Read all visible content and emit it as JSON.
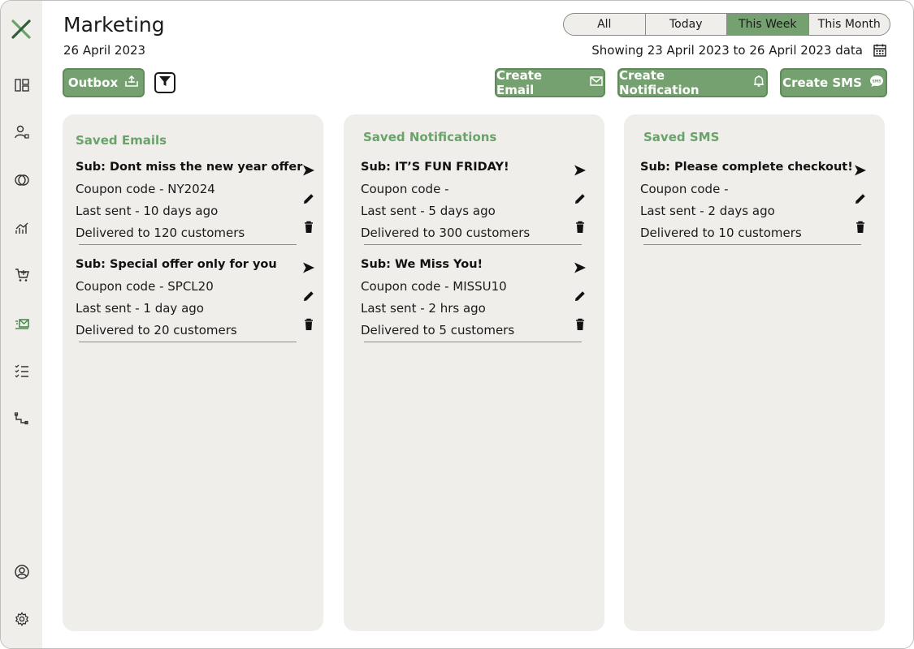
{
  "header": {
    "title": "Marketing",
    "date": "26 April 2023",
    "showing": "Showing 23 April 2023 to 26 April 2023 data"
  },
  "range_tabs": [
    {
      "label": "All",
      "active": false
    },
    {
      "label": "Today",
      "active": false
    },
    {
      "label": "This Week",
      "active": true
    },
    {
      "label": "This Month",
      "active": false
    }
  ],
  "toolbar": {
    "outbox_label": "Outbox",
    "create_email_label": "Create Email",
    "create_notification_label": "Create Notification",
    "create_sms_label": "Create SMS"
  },
  "panels": {
    "emails": {
      "title": "Saved Emails",
      "items": [
        {
          "subject": "Sub: Dont miss the new year offer",
          "coupon": "Coupon code - NY2024",
          "last_sent": "Last sent - 10 days ago",
          "delivered": "Delivered to 120 customers"
        },
        {
          "subject": "Sub: Special offer only for you",
          "coupon": "Coupon code - SPCL20",
          "last_sent": "Last sent - 1 day ago",
          "delivered": "Delivered to 20 customers"
        }
      ]
    },
    "notifications": {
      "title": "Saved Notifications",
      "items": [
        {
          "subject": "Sub: IT’S FUN FRIDAY!",
          "coupon": "Coupon code -",
          "last_sent": "Last sent - 5 days ago",
          "delivered": "Delivered to 300 customers"
        },
        {
          "subject": "Sub: We Miss You!",
          "coupon": "Coupon code - MISSU10",
          "last_sent": "Last sent - 2 hrs ago",
          "delivered": "Delivered to 5 customers"
        }
      ]
    },
    "sms": {
      "title": "Saved SMS",
      "items": [
        {
          "subject": "Sub: Please complete checkout!",
          "coupon": "Coupon code -",
          "last_sent": "Last sent - 2 days ago",
          "delivered": "Delivered to 10 customers"
        }
      ]
    }
  },
  "sidebar": {
    "icons": [
      "logo-x-icon",
      "dashboard-icon",
      "user-icon",
      "discount-icon",
      "analytics-icon",
      "cart-icon",
      "marketing-icon",
      "tasks-icon",
      "integrations-icon",
      "account-icon",
      "settings-icon"
    ]
  },
  "colors": {
    "accent": "#74a16f",
    "panel_bg": "#efeeea",
    "sidebar_bg": "#efeeea",
    "panel_title": "#6aa36a"
  }
}
